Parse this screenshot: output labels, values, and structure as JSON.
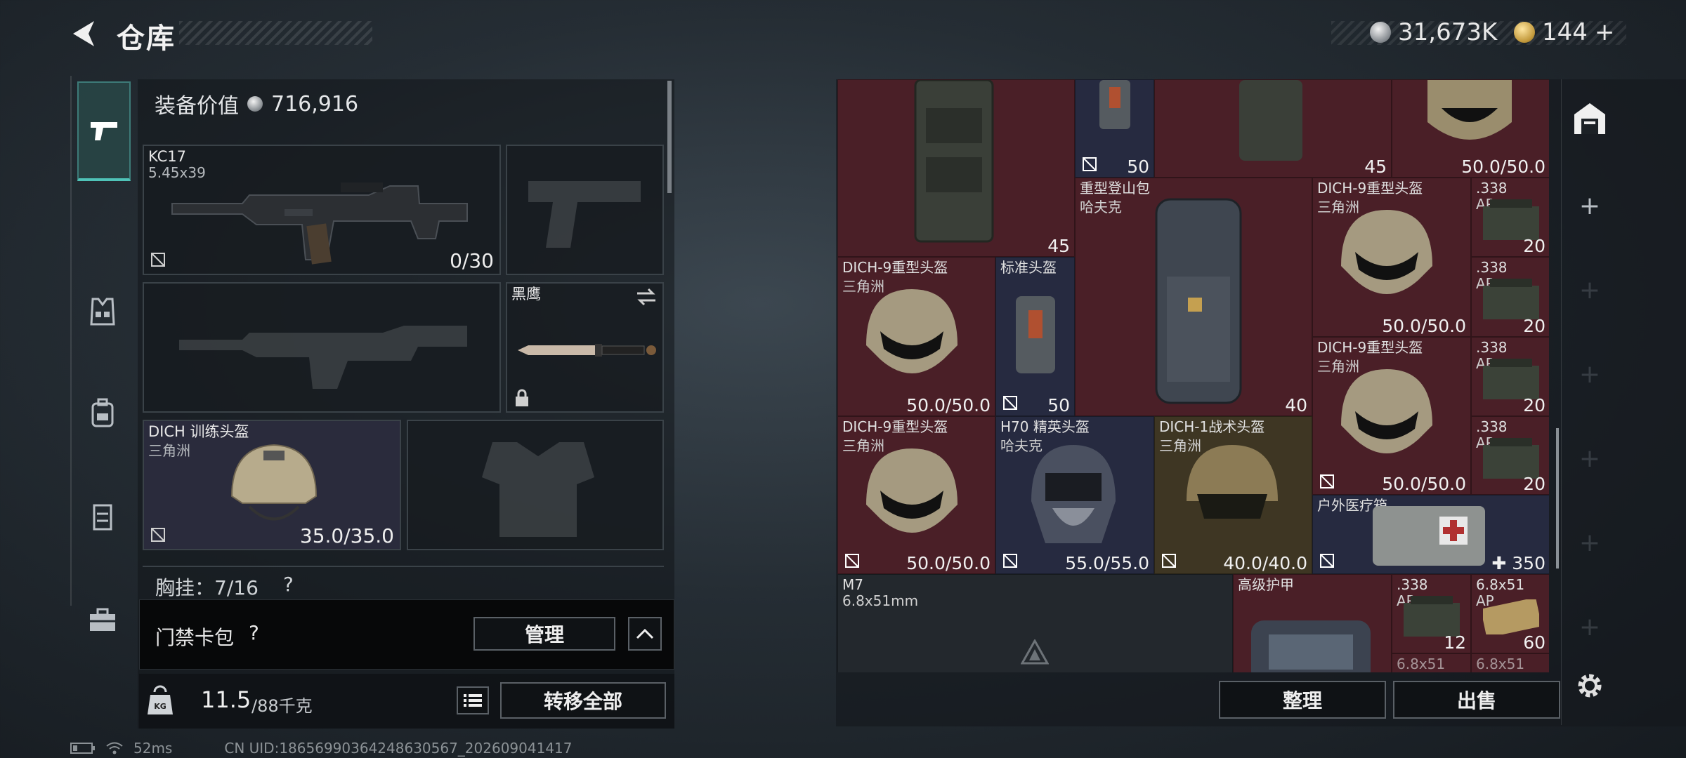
{
  "header": {
    "title": "仓库",
    "silver_amount": "31,673K",
    "gold_amount": "144",
    "gold_plus": "+"
  },
  "equipment": {
    "value_label": "装备价值",
    "value": "716,916",
    "primary": {
      "name": "KC17",
      "ammo": "5.45x39",
      "count": "0/30"
    },
    "melee": {
      "name": "黑鹰"
    },
    "helmet": {
      "name": "DICH 训练头盔",
      "source": "三角洲",
      "durability": "35.0/35.0"
    },
    "chest_rig": {
      "label": "胸挂：7/16",
      "q": "?"
    }
  },
  "key_case": {
    "label": "门禁卡包",
    "help": "?",
    "manage_button": "管理"
  },
  "weight": {
    "current": "11.5",
    "max": "/88千克",
    "transfer_button": "转移全部",
    "kg_icon": "KG"
  },
  "storage": {
    "items": [
      {
        "name": "",
        "sub": "",
        "value": "45"
      },
      {
        "name": "",
        "sub": "",
        "value": "50"
      },
      {
        "name": "",
        "sub": "",
        "value": "45"
      },
      {
        "name": "",
        "sub": "",
        "value": "50.0/50.0"
      },
      {
        "name": "重型登山包",
        "sub": "哈夫克",
        "value": "40"
      },
      {
        "name": "DICH-9重型头盔",
        "sub": "三角洲",
        "value": "50.0/50.0"
      },
      {
        "name": ".338",
        "sub": "AP",
        "value": "20"
      },
      {
        "name": ".338",
        "sub": "AP",
        "value": "20"
      },
      {
        "name": "DICH-9重型头盔",
        "sub": "三角洲",
        "value": "50.0/50.0"
      },
      {
        "name": "标准头盔",
        "sub": "",
        "value": "50"
      },
      {
        "name": "DICH-9重型头盔",
        "sub": "三角洲",
        "value": "50.0/50.0"
      },
      {
        "name": ".338",
        "sub": "AP",
        "value": "20"
      },
      {
        "name": ".338",
        "sub": "AP",
        "value": "20"
      },
      {
        "name": "DICH-9重型头盔",
        "sub": "三角洲",
        "value": "50.0/50.0"
      },
      {
        "name": "H70 精英头盔",
        "sub": "哈夫克",
        "value": "55.0/55.0"
      },
      {
        "name": "DICH-1战术头盔",
        "sub": "三角洲",
        "value": "40.0/40.0"
      },
      {
        "name": "户外医疗箱",
        "sub": "",
        "value": "350"
      },
      {
        "name": "M7",
        "sub": "6.8x51mm",
        "value": ""
      },
      {
        "name": "高级护甲",
        "sub": "",
        "value": ""
      },
      {
        "name": ".338",
        "sub": "AP",
        "value": "12"
      },
      {
        "name": "6.8x51",
        "sub": "AP",
        "value": "60"
      },
      {
        "name": "6.8x51",
        "sub": "",
        "value": ""
      },
      {
        "name": "6.8x51",
        "sub": "",
        "value": ""
      }
    ],
    "sort_button": "整理",
    "sell_button": "出售"
  },
  "status_bar": {
    "ping": "52ms",
    "uid": "CN UID:18656990364248630567_202609041417"
  },
  "colors": {
    "rare_red": "#4a1f27",
    "epic_navy": "#262a40",
    "legend_gold": "#3e3623",
    "accent_teal": "#4fc3b8"
  }
}
